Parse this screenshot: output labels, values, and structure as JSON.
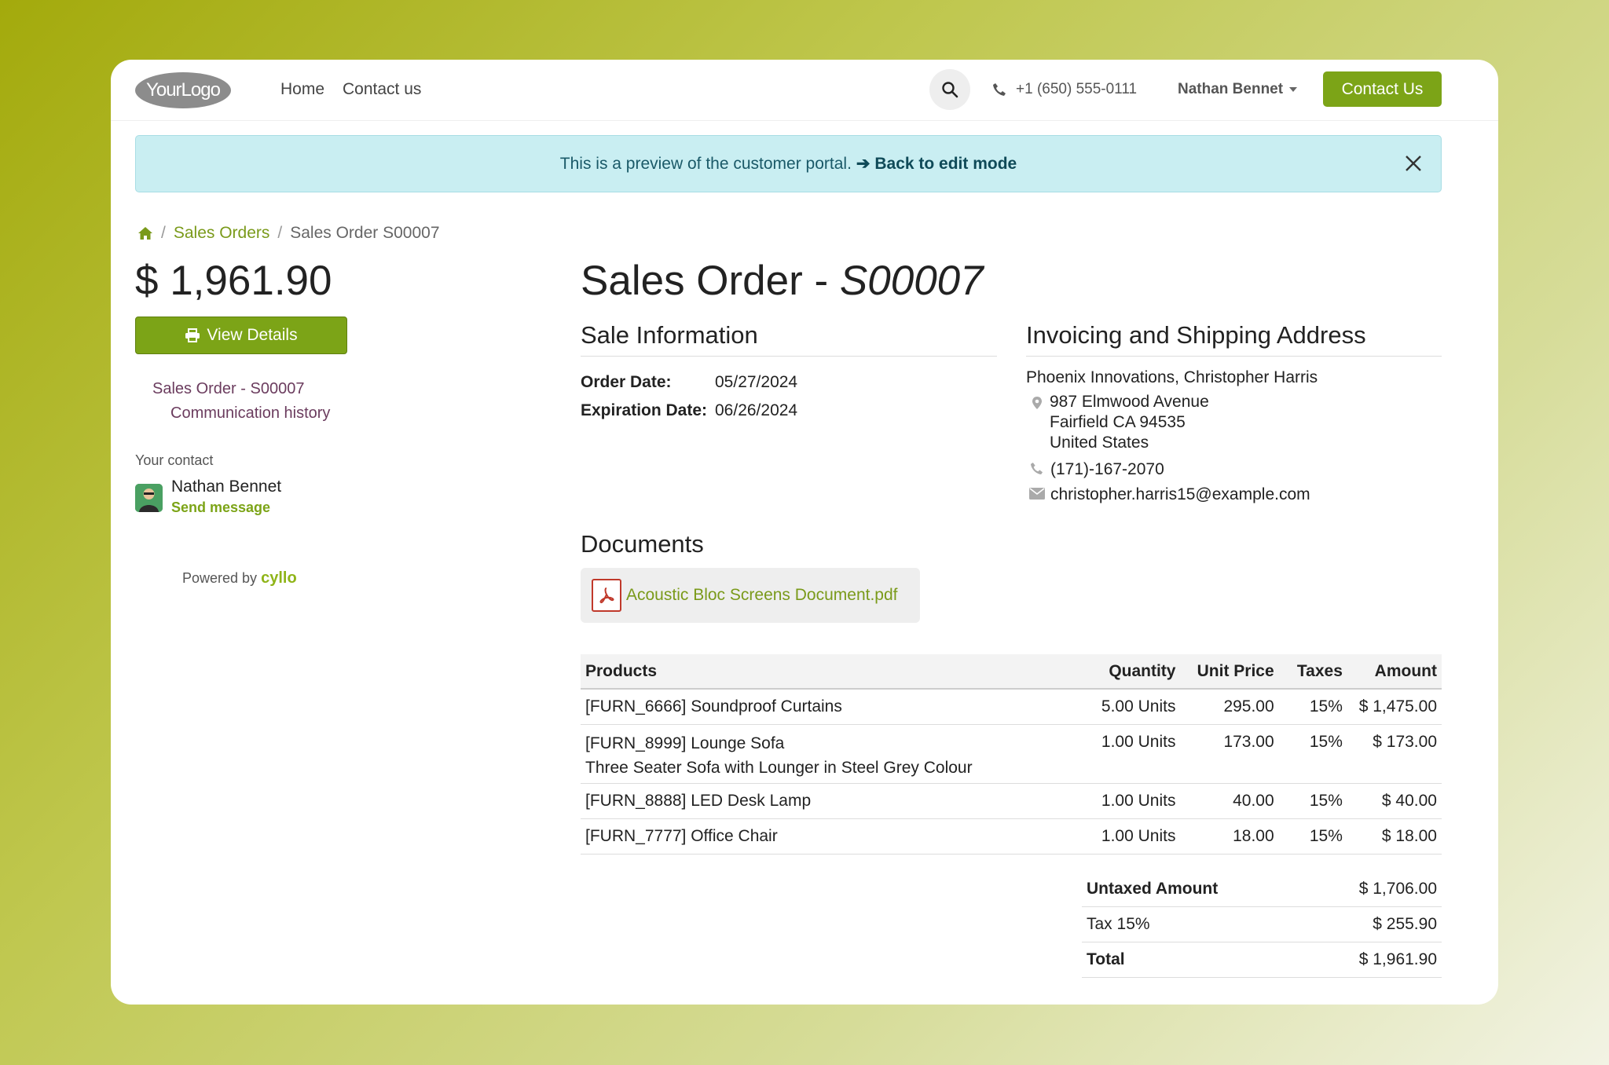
{
  "header": {
    "logo_text": "YourLogo",
    "nav": [
      "Home",
      "Contact us"
    ],
    "phone": "+1 (650) 555-0111",
    "user": "Nathan Bennet",
    "contact_button": "Contact Us"
  },
  "banner": {
    "text": "This is a preview of the customer portal.",
    "link": "➔ Back to edit mode"
  },
  "breadcrumb": {
    "items": [
      "Sales Orders",
      "Sales Order S00007"
    ]
  },
  "sidebar": {
    "total": "$ 1,961.90",
    "view_details": "View Details",
    "link_order": "Sales Order - S00007",
    "link_history": "Communication history",
    "contact_label": "Your contact",
    "contact_name": "Nathan Bennet",
    "send_message": "Send message",
    "powered_by": "Powered by",
    "powered_brand": "cyllo"
  },
  "order": {
    "title_prefix": "Sales Order - ",
    "title_number": "S00007",
    "sale_info_title": "Sale Information",
    "order_date_label": "Order Date:",
    "order_date": "05/27/2024",
    "expiration_label": "Expiration Date:",
    "expiration_date": "06/26/2024",
    "address_title": "Invoicing and Shipping Address",
    "customer": "Phoenix Innovations, Christopher Harris",
    "street": "987 Elmwood Avenue",
    "city": "Fairfield CA 94535",
    "country": "United States",
    "phone": "(171)-167-2070",
    "email": "christopher.harris15@example.com",
    "documents_title": "Documents",
    "document_name": "Acoustic Bloc Screens Document.pdf"
  },
  "table": {
    "headers": {
      "products": "Products",
      "quantity": "Quantity",
      "unit_price": "Unit Price",
      "taxes": "Taxes",
      "amount": "Amount"
    },
    "rows": [
      {
        "product": "[FURN_6666] Soundproof Curtains",
        "desc": "",
        "qty": "5.00 Units",
        "price": "295.00",
        "tax": "15%",
        "amount": "$ 1,475.00"
      },
      {
        "product": "[FURN_8999] Lounge Sofa",
        "desc": "Three Seater Sofa with Lounger in Steel Grey Colour",
        "qty": "1.00 Units",
        "price": "173.00",
        "tax": "15%",
        "amount": "$ 173.00"
      },
      {
        "product": "[FURN_8888] LED Desk Lamp",
        "desc": "",
        "qty": "1.00 Units",
        "price": "40.00",
        "tax": "15%",
        "amount": "$ 40.00"
      },
      {
        "product": "[FURN_7777] Office Chair",
        "desc": "",
        "qty": "1.00 Units",
        "price": "18.00",
        "tax": "15%",
        "amount": "$ 18.00"
      }
    ]
  },
  "totals": {
    "untaxed_label": "Untaxed Amount",
    "untaxed": "$ 1,706.00",
    "tax_label": "Tax 15%",
    "tax": "$ 255.90",
    "total_label": "Total",
    "total": "$ 1,961.90"
  },
  "colors": {
    "accent": "#7ca417",
    "banner_bg": "#c9eef2",
    "link_purple": "#6b3c5e"
  }
}
